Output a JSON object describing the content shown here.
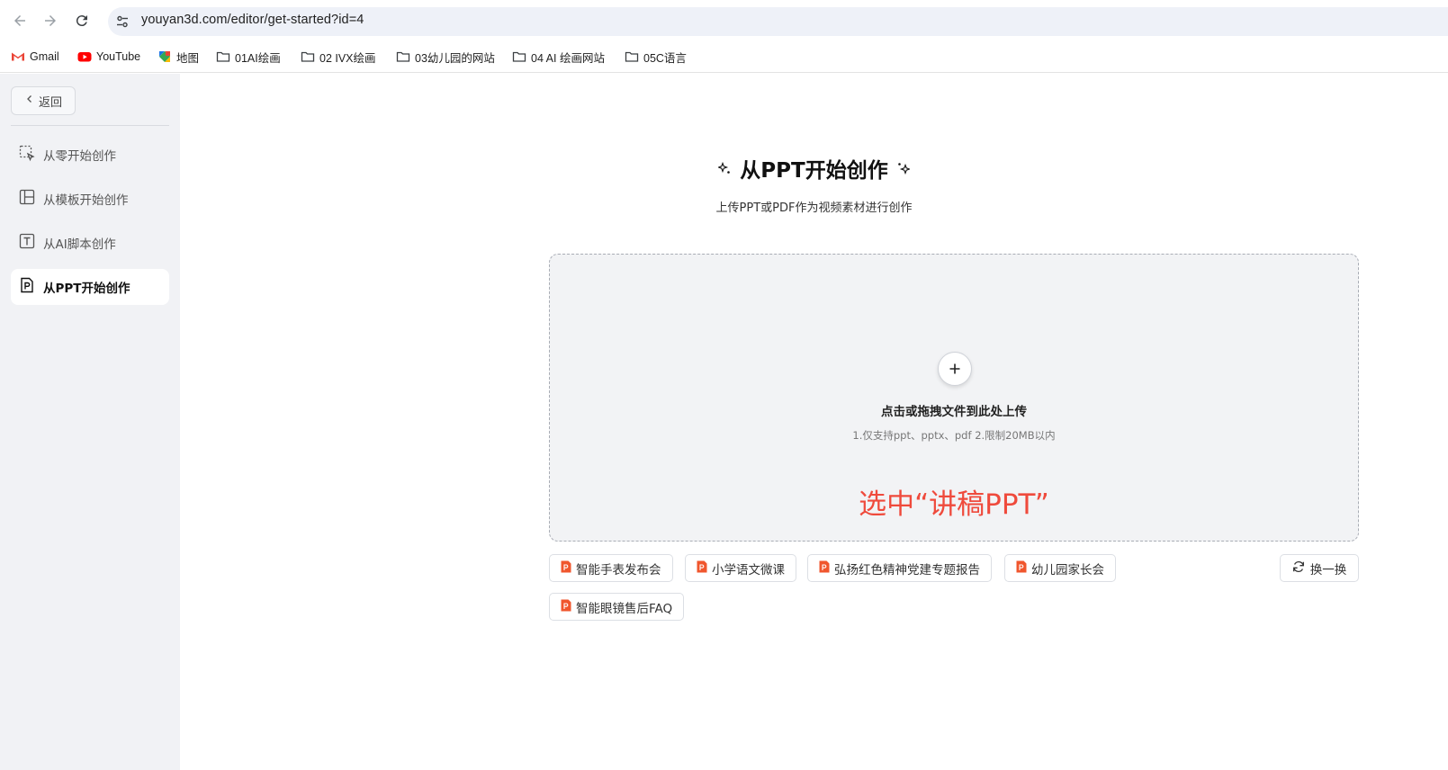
{
  "browser": {
    "url": "youyan3d.com/editor/get-started?id=4",
    "bookmarks": [
      {
        "label": "Gmail",
        "icon": "gmail-icon"
      },
      {
        "label": "YouTube",
        "icon": "youtube-icon"
      },
      {
        "label": "地图",
        "icon": "maps-icon"
      },
      {
        "label": "01AI绘画",
        "icon": "folder-icon"
      },
      {
        "label": "02 IVX绘画",
        "icon": "folder-icon"
      },
      {
        "label": "03幼儿园的网站",
        "icon": "folder-icon"
      },
      {
        "label": "04 AI 绘画网站",
        "icon": "folder-icon"
      },
      {
        "label": "05C语言",
        "icon": "folder-icon"
      }
    ]
  },
  "sidebar": {
    "back_label": "返回",
    "items": [
      {
        "label": "从零开始创作",
        "icon": "blank-canvas-icon",
        "active": false
      },
      {
        "label": "从模板开始创作",
        "icon": "template-layout-icon",
        "active": false
      },
      {
        "label": "从AI脚本创作",
        "icon": "text-script-icon",
        "active": false
      },
      {
        "label": "从PPT开始创作",
        "icon": "ppt-file-icon",
        "active": true
      }
    ]
  },
  "main": {
    "title": "从PPT开始创作",
    "subtitle": "上传PPT或PDF作为视频素材进行创作",
    "upload": {
      "title": "点击或拖拽文件到此处上传",
      "hint": "1.仅支持ppt、pptx、pdf  2.限制20MB以内",
      "annotation": "选中“讲稿PPT”"
    },
    "samples": [
      "智能手表发布会",
      "小学语文微课",
      "弘扬红色精神党建专题报告",
      "幼儿园家长会",
      "智能眼镜售后FAQ"
    ],
    "refresh_label": "换一换"
  },
  "colors": {
    "accent_annotation": "#ef4a3c",
    "ppt_icon": "#f0562d",
    "sidebar_bg": "#f1f2f5"
  }
}
